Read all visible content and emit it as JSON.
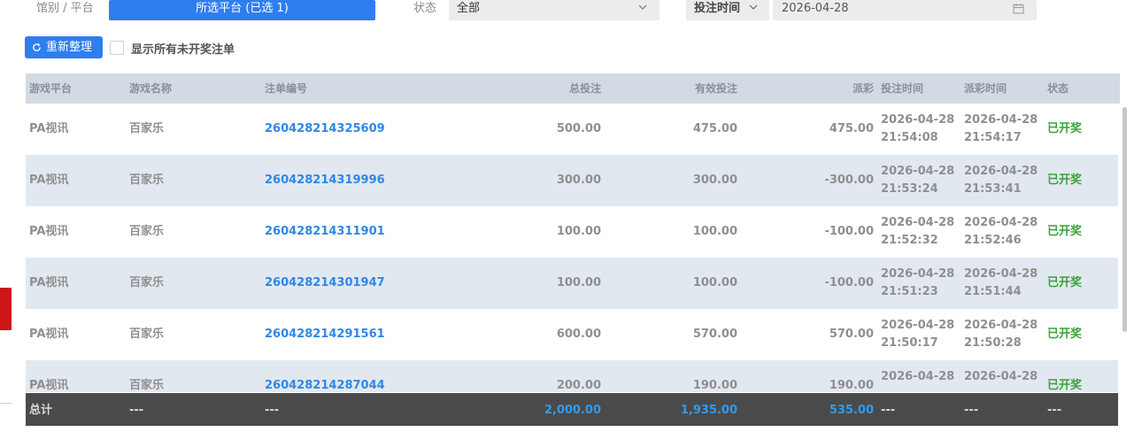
{
  "filters": {
    "platform_label": "馆别 / 平台",
    "platform_button": "所选平台 (已选 1)",
    "status_label": "状态",
    "status_value": "全部",
    "time_type": "投注时间",
    "date_value": "2026-04-28"
  },
  "actions": {
    "refresh_label": "重新整理",
    "show_unsettled_label": "显示所有未开奖注单"
  },
  "table": {
    "headers": [
      "游戏平台",
      "游戏名称",
      "注单编号",
      "总投注",
      "有效投注",
      "派彩",
      "投注时间",
      "派彩时间",
      "状态"
    ],
    "rows": [
      {
        "platform": "PA视讯",
        "game": "百家乐",
        "id": "260428214325609",
        "total": "500.00",
        "valid": "475.00",
        "payout": "475.00",
        "bet_date": "2026-04-28",
        "bet_clock": "21:54:08",
        "pay_date": "2026-04-28",
        "pay_clock": "21:54:17",
        "status": "已开奖"
      },
      {
        "platform": "PA视讯",
        "game": "百家乐",
        "id": "260428214319996",
        "total": "300.00",
        "valid": "300.00",
        "payout": "-300.00",
        "bet_date": "2026-04-28",
        "bet_clock": "21:53:24",
        "pay_date": "2026-04-28",
        "pay_clock": "21:53:41",
        "status": "已开奖"
      },
      {
        "platform": "PA视讯",
        "game": "百家乐",
        "id": "260428214311901",
        "total": "100.00",
        "valid": "100.00",
        "payout": "-100.00",
        "bet_date": "2026-04-28",
        "bet_clock": "21:52:32",
        "pay_date": "2026-04-28",
        "pay_clock": "21:52:46",
        "status": "已开奖"
      },
      {
        "platform": "PA视讯",
        "game": "百家乐",
        "id": "260428214301947",
        "total": "100.00",
        "valid": "100.00",
        "payout": "-100.00",
        "bet_date": "2026-04-28",
        "bet_clock": "21:51:23",
        "pay_date": "2026-04-28",
        "pay_clock": "21:51:44",
        "status": "已开奖"
      },
      {
        "platform": "PA视讯",
        "game": "百家乐",
        "id": "260428214291561",
        "total": "600.00",
        "valid": "570.00",
        "payout": "570.00",
        "bet_date": "2026-04-28",
        "bet_clock": "21:50:17",
        "pay_date": "2026-04-28",
        "pay_clock": "21:50:28",
        "status": "已开奖"
      },
      {
        "platform": "PA视讯",
        "game": "百家乐",
        "id": "260428214287044",
        "total": "200.00",
        "valid": "190.00",
        "payout": "190.00",
        "bet_date": "2026-04-28",
        "bet_clock": "",
        "pay_date": "2026-04-28",
        "pay_clock": "",
        "status": "已开奖"
      }
    ]
  },
  "footer": {
    "label": "总计",
    "platform": "---",
    "game": "---",
    "id": "---",
    "total": "2,000.00",
    "valid": "1,935.00",
    "payout": "535.00",
    "bet_time": "---",
    "pay_time": "---",
    "status": "---"
  },
  "colors": {
    "accent": "#2f7ef0",
    "link": "#2f88e6",
    "status_settled": "#3ca33c",
    "footer_bg": "#4a4a4a"
  },
  "icons": {
    "status_select": "chevron-down-icon",
    "time_type_select": "chevron-down-icon",
    "date_input": "calendar-icon",
    "refresh_button": "refresh-icon"
  }
}
